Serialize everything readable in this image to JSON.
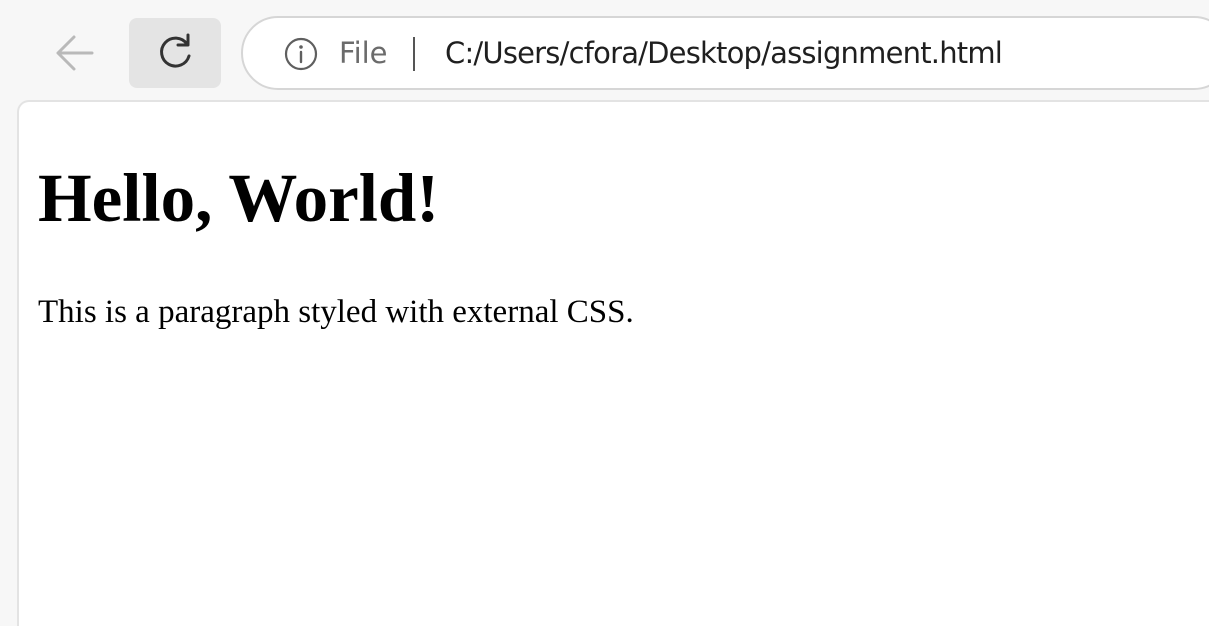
{
  "toolbar": {
    "back_icon": "arrow-left-icon",
    "reload_icon": "reload-icon",
    "info_icon": "info-icon"
  },
  "address_bar": {
    "scheme_label": "File",
    "url": "C:/Users/cfora/Desktop/assignment.html"
  },
  "page": {
    "heading": "Hello, World!",
    "paragraph": "This is a paragraph styled with external CSS."
  },
  "colors": {
    "chrome_background": "#f7f7f7",
    "reload_button_bg": "#e4e4e4",
    "page_background": "#ffffff",
    "disabled_icon": "#b9b9b9",
    "active_icon": "#333333"
  }
}
